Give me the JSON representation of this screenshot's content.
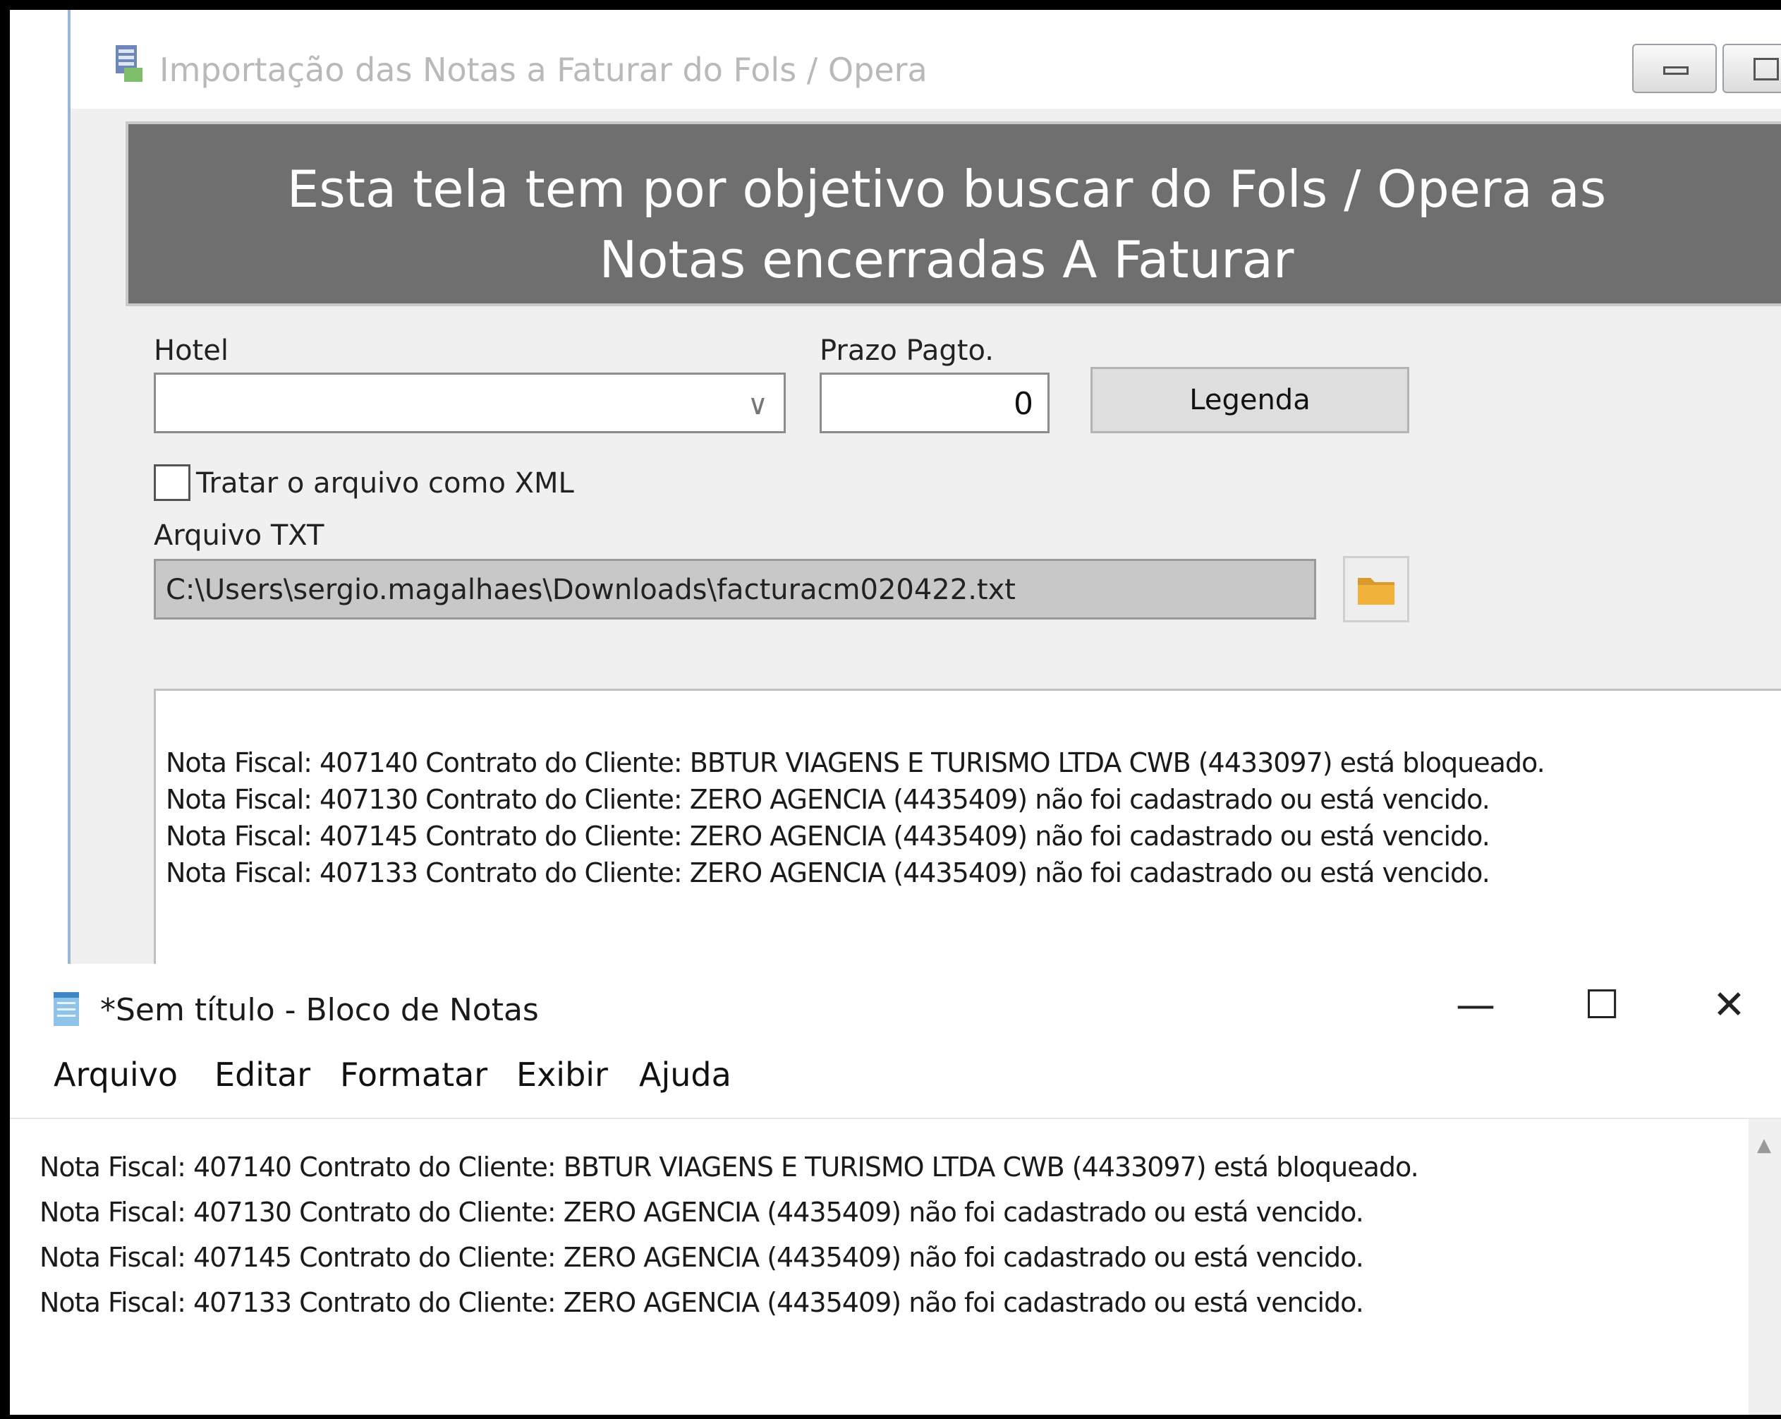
{
  "app_window": {
    "title": "Importação das Notas a Faturar do Fols / Opera",
    "banner_line1": "Esta tela tem por objetivo buscar do Fols / Opera as",
    "banner_line2": "Notas encerradas A Faturar",
    "hotel_label": "Hotel",
    "hotel_value": "",
    "prazo_label": "Prazo Pagto.",
    "prazo_value": "0",
    "legenda_button": "Legenda",
    "xml_checkbox_label": "Tratar o arquivo como XML",
    "xml_checked": false,
    "arquivo_label": "Arquivo TXT",
    "arquivo_value": "C:\\Users\\sergio.magalhaes\\Downloads\\facturacm020422.txt",
    "log": [
      "Nota Fiscal: 407140 Contrato do Cliente: BBTUR VIAGENS E TURISMO LTDA  CWB (4433097)  está bloqueado.",
      "Nota Fiscal: 407130 Contrato do Cliente: ZERO AGENCIA (4435409)  não foi cadastrado ou está vencido.",
      "Nota Fiscal: 407145 Contrato do Cliente: ZERO AGENCIA (4435409)  não foi cadastrado ou está vencido.",
      "Nota Fiscal: 407133 Contrato do Cliente: ZERO AGENCIA (4435409)  não foi cadastrado ou está vencido."
    ]
  },
  "notepad": {
    "title": "*Sem título - Bloco de Notas",
    "minimize": "—",
    "maximize": "☐",
    "close": "✕",
    "menu": [
      "Arquivo",
      "Editar",
      "Formatar",
      "Exibir",
      "Ajuda"
    ],
    "lines": [
      "Nota Fiscal: 407140 Contrato do Cliente: BBTUR VIAGENS E TURISMO LTDA  CWB (4433097)  está bloqueado.",
      "Nota Fiscal: 407130 Contrato do Cliente: ZERO AGENCIA (4435409)  não foi cadastrado ou está vencido.",
      "Nota Fiscal: 407145 Contrato do Cliente: ZERO AGENCIA (4435409)  não foi cadastrado ou está vencido.",
      "Nota Fiscal: 407133 Contrato do Cliente: ZERO AGENCIA (4435409)  não foi cadastrado ou está vencido."
    ]
  },
  "icons": {
    "app_icon": "app-form-icon",
    "folder": "folder-icon",
    "dropdown": "chevron-down-icon",
    "notepad_icon": "notepad-icon"
  },
  "colors": {
    "banner_bg": "#6f6f6f",
    "banner_text": "#ffffff",
    "app_bg": "#f0f0f0",
    "folder": "#f0b23a"
  }
}
